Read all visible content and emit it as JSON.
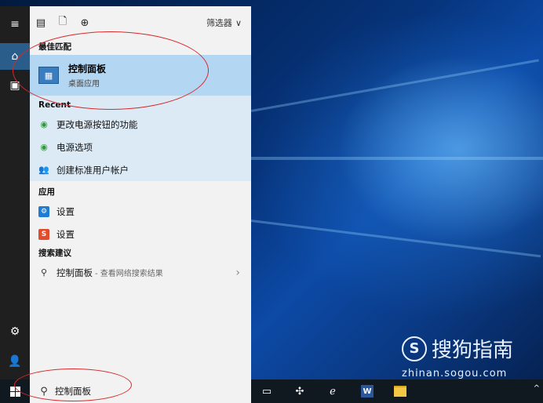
{
  "rail": {
    "items": [
      {
        "name": "menu",
        "glyph": "≡"
      },
      {
        "name": "home",
        "glyph": "⌂"
      },
      {
        "name": "documents",
        "glyph": "▣"
      },
      {
        "name": "settings",
        "glyph": "⚙"
      },
      {
        "name": "user",
        "glyph": "👤"
      }
    ]
  },
  "topbar": {
    "icons": [
      "▤",
      "🗋",
      "⊕"
    ],
    "filter_label": "筛选器",
    "filter_glyph": "∨"
  },
  "best_match": {
    "header": "最佳匹配",
    "title": "控制面板",
    "subtitle": "桌面应用",
    "icon_glyph": "▦"
  },
  "recent": {
    "header": "Recent",
    "items": [
      {
        "label": "更改电源按钮的功能",
        "icon": "globe"
      },
      {
        "label": "电源选项",
        "icon": "globe"
      },
      {
        "label": "创建标准用户帐户",
        "icon": "user"
      }
    ]
  },
  "apps": {
    "header": "应用",
    "items": [
      {
        "label": "设置",
        "icon": "gear"
      },
      {
        "label": "设置",
        "icon": "s-logo"
      }
    ]
  },
  "suggestions": {
    "header": "搜索建议",
    "item": {
      "label": "控制面板",
      "suffix": "- 查看网络搜索结果",
      "chevron": "›"
    }
  },
  "search": {
    "value": "控制面板",
    "icon": "⚲"
  },
  "taskbar": {
    "apps": [
      "task-view",
      "fan-app",
      "ie",
      "word",
      "file-explorer"
    ],
    "word_letter": "W",
    "tray_glyph": "^"
  },
  "watermark": {
    "brand": "搜狗指南",
    "logo_letter": "S",
    "url": "zhinan.sogou.com"
  },
  "colors": {
    "accent": "#2b5d8a",
    "selected": "#b3d7f3",
    "annotation": "#d8282a"
  }
}
